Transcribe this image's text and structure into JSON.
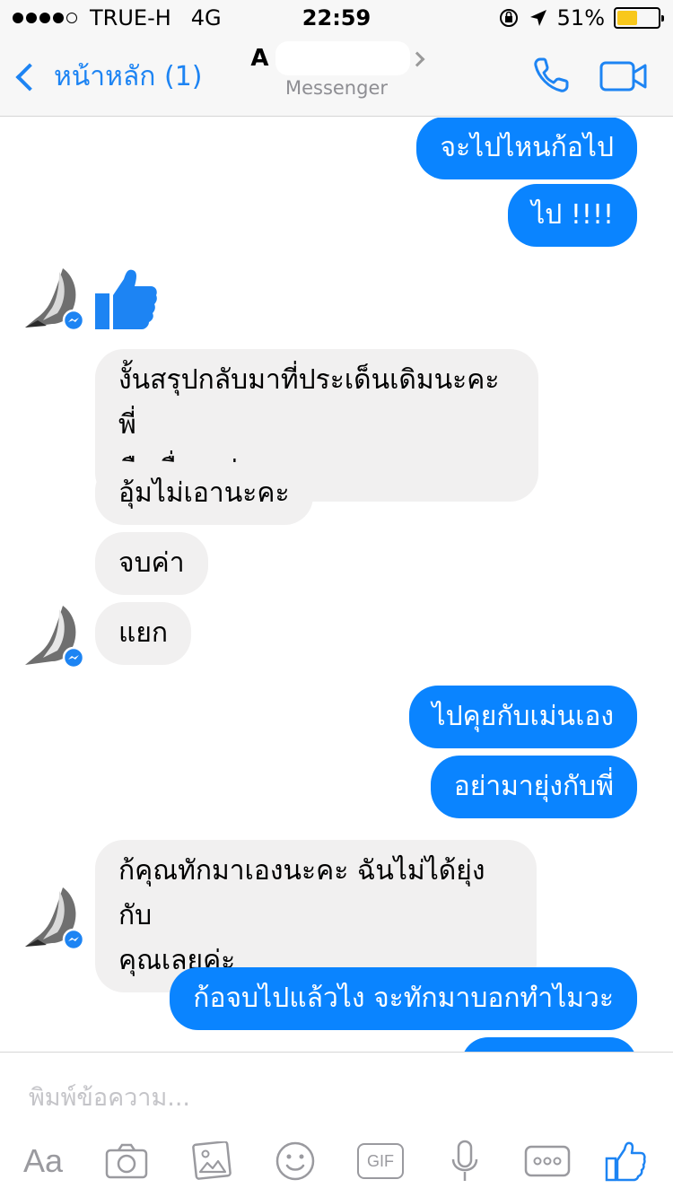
{
  "status_bar": {
    "carrier": "TRUE-H",
    "network": "4G",
    "time": "22:59",
    "battery_percent": "51%",
    "battery_level": 0.51,
    "battery_color": "#f8c81c"
  },
  "navbar": {
    "back_label": "หน้าหลัก (1)",
    "title": "A",
    "subtitle": "Messenger",
    "accent_color": "#1d84f3"
  },
  "messages": [
    {
      "side": "out",
      "text": "จะไปไหนก้อไป"
    },
    {
      "side": "out",
      "text": "ไป !!!!"
    },
    {
      "side": "in",
      "type": "like-sticker"
    },
    {
      "side": "in",
      "text_line1": "งั้นสรุปกลับมาที่ประเด็นเดิมนะคะพี่",
      "text_line2": "คือเรื่องรูป"
    },
    {
      "side": "in",
      "text": "อุ้มไม่เอานะคะ"
    },
    {
      "side": "in",
      "text": "จบค่า"
    },
    {
      "side": "in",
      "text": "แยก"
    },
    {
      "side": "out",
      "text": "ไปคุยกับเม่นเอง"
    },
    {
      "side": "out",
      "text": "อย่ามายุ่งกับพี่"
    },
    {
      "side": "in",
      "text_line1": "ก้คุณทักมาเองนะคะ ฉันไม่ได้ยุ่งกับ",
      "text_line2": "คุณเลยค่ะ"
    },
    {
      "side": "out",
      "text": "ก้อจบไปแล้วไง จะทักมาบอกทำไมวะ"
    }
  ],
  "composer": {
    "placeholder": "พิมพ์ข้อความ...",
    "aa_label": "Aa",
    "gif_label": "GIF"
  },
  "colors": {
    "outgoing_bubble": "#0a84ff",
    "incoming_bubble": "#f1f0f0",
    "like_blue": "#1d84f3"
  },
  "icons": [
    "phone-icon",
    "video-camera-icon",
    "camera-icon",
    "photo-icon",
    "emoji-icon",
    "gif-icon",
    "microphone-icon",
    "more-icon",
    "thumbs-up-icon",
    "messenger-badge-icon"
  ]
}
